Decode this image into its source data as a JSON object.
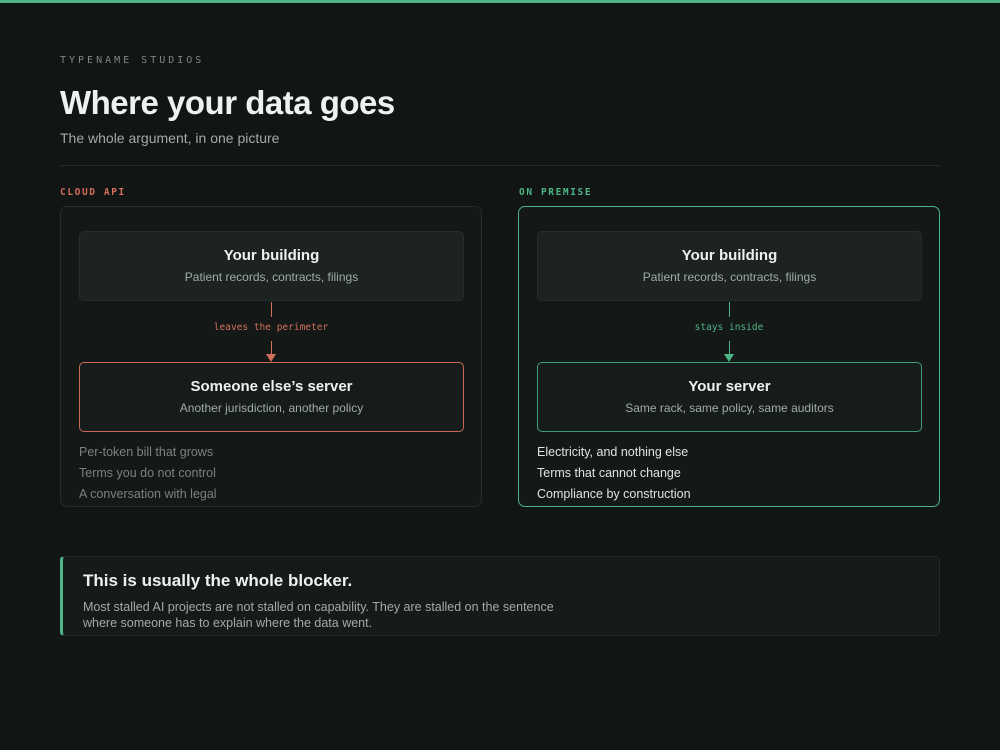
{
  "eyebrow": "TYPENAME STUDIOS",
  "title": "Where your data goes",
  "subtitle": "The whole argument, in one picture",
  "colors": {
    "accent_green": "#4fb585",
    "accent_red": "#d36f5a",
    "background": "#111514"
  },
  "cloud": {
    "label": "CLOUD API",
    "source": {
      "title": "Your building",
      "sub": "Patient records, contracts, filings"
    },
    "flow_label": "leaves the perimeter",
    "destination": {
      "title": "Someone else’s server",
      "sub": "Another jurisdiction, another policy"
    },
    "points": [
      "Per-token bill that grows",
      "Terms you do not control",
      "A conversation with legal"
    ]
  },
  "on_premise": {
    "label": "ON PREMISE",
    "source": {
      "title": "Your building",
      "sub": "Patient records, contracts, filings"
    },
    "flow_label": "stays inside",
    "destination": {
      "title": "Your server",
      "sub": "Same rack, same policy, same auditors"
    },
    "points": [
      "Electricity, and nothing else",
      "Terms that cannot change",
      "Compliance by construction"
    ]
  },
  "callout": {
    "title": "This is usually the whole blocker.",
    "body_line1": "Most stalled AI projects are not stalled on capability. They are stalled on the sentence",
    "body_line2": "where someone has to explain where the data went."
  }
}
